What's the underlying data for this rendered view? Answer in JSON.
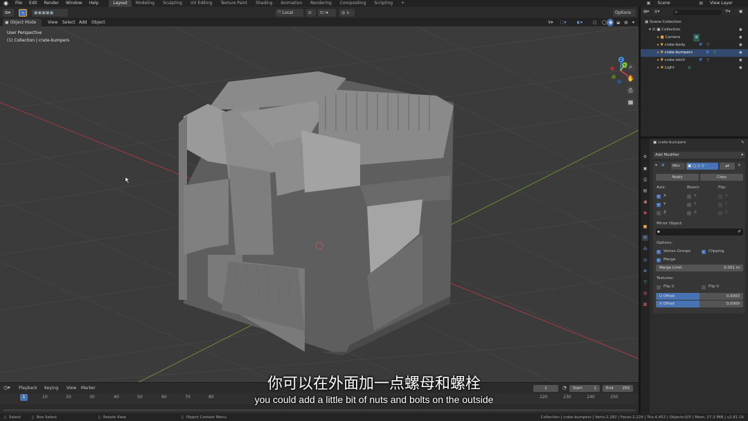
{
  "menu": {
    "logo": "blender-logo",
    "items": [
      "File",
      "Edit",
      "Render",
      "Window",
      "Help"
    ]
  },
  "workspaces": [
    "Layout",
    "Modeling",
    "Sculpting",
    "UV Editing",
    "Texture Paint",
    "Shading",
    "Animation",
    "Rendering",
    "Compositing",
    "Scripting"
  ],
  "workspace_add": "+",
  "scene_label": "Scene",
  "view_layer_label": "View Layer",
  "header": {
    "transform_orientation": "Local",
    "options_label": "Options",
    "mode": "Object Mode",
    "menus": [
      "View",
      "Select",
      "Add",
      "Object"
    ]
  },
  "viewport": {
    "perspective_label": "User Perspective",
    "collection_label": "(1) Collection | crate-bumpers",
    "gizmo_axes": {
      "x": "X",
      "y": "Y",
      "z": "Z"
    }
  },
  "outliner": {
    "root": "Scene Collection",
    "collection": "Collection",
    "objects": [
      "Camera",
      "crate-body",
      "crate-bumpers",
      "crate-latch",
      "Light"
    ]
  },
  "properties": {
    "object_name": "crate-bumpers",
    "add_modifier": "Add Modifier",
    "modifier_name": "Mirr",
    "apply": "Apply",
    "copy": "Copy",
    "axis_label": "Axis:",
    "bisect_label": "Bisect:",
    "flip_label": "Flip:",
    "axes": [
      "X",
      "Y",
      "Z"
    ],
    "mirror_object_label": "Mirror Object:",
    "options_label": "Options:",
    "vertex_groups": "Vertex Groups",
    "clipping": "Clipping",
    "merge": "Merge",
    "merge_limit_label": "Merge Limit",
    "merge_limit_value": "0.001 m",
    "textures_label": "Textures:",
    "flip_u": "Flip U",
    "flip_v": "Flip V",
    "u_offset_label": "U Offset",
    "u_offset_value": "0.0000",
    "v_offset_label": "V Offset",
    "v_offset_value": "0.0000"
  },
  "timeline": {
    "menus": [
      "Playback",
      "Keying",
      "View",
      "Marker"
    ],
    "current_frame": "1",
    "start_label": "Start",
    "start_value": "1",
    "end_label": "End",
    "end_value": "250",
    "ticks": [
      "1",
      "10",
      "20",
      "30",
      "40",
      "50",
      "60",
      "70",
      "80",
      "220",
      "230",
      "240",
      "250"
    ],
    "playhead": "1"
  },
  "status": {
    "select": "Select",
    "box_select": "Box Select",
    "rotate_view": "Rotate View",
    "context_menu": "Object Context Menu",
    "stats": "Collection | crate-bumpers | Verts:2,282 | Faces:2,224 | Tris:4,452 | Objects:0/5 | Mem: 27.3 MiB | v2.81.16"
  },
  "subtitles": {
    "zh": "你可以在外面加一点螺母和螺栓",
    "en": "you could add a little bit of nuts and bolts on the outside"
  },
  "colors": {
    "accent": "#4772b3",
    "axis_x": "#e5404e",
    "axis_y": "#8ccd3c",
    "axis_z": "#4a8fe2"
  }
}
